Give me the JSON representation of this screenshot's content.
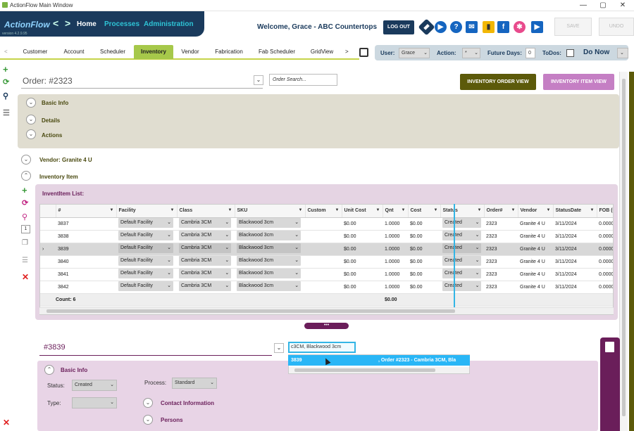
{
  "window": {
    "title": "ActionFlow Main Window",
    "min": "—",
    "max": "▢",
    "close": "✕"
  },
  "nav": {
    "logo": "ActionFlow",
    "version": "version 4.2.9.95",
    "back": "<",
    "fwd": ">",
    "items": [
      "Home",
      "Processes",
      "Administration"
    ]
  },
  "header": {
    "welcome": "Welcome, Grace - ABC Countertops",
    "logout": "LOG OUT",
    "save": "SAVE",
    "undo": "UNDO"
  },
  "tabs": {
    "prev": "<",
    "items": [
      "Customer",
      "Account",
      "Scheduler",
      "Inventory",
      "Vendor",
      "Fabrication",
      "Fab Scheduler",
      "GridView"
    ],
    "next": ">",
    "active": "Inventory"
  },
  "filters": {
    "user_label": "User:",
    "user_value": "Grace",
    "action_label": "Action:",
    "action_value": "*",
    "future_label": "Future Days:",
    "future_value": "0",
    "todos_label": "ToDos:",
    "donow": "Do Now"
  },
  "order": {
    "title": "Order:  #2323",
    "search_placeholder": "Order Search...",
    "btn_order_view": "INVENTORY ORDER VIEW",
    "btn_item_view": "INVENTORY ITEM VIEW",
    "sections": [
      "Basic Info",
      "Details",
      "Actions"
    ]
  },
  "vendor": {
    "label": "Vendor: Granite 4 U",
    "inv_label": "Inventory Item"
  },
  "invlist": {
    "title": "InventItem List:",
    "columns": [
      "#",
      "Facility",
      "Class",
      "SKU",
      "Custom",
      "Unit Cost",
      "Qnt",
      "Cost",
      "Status",
      "Order#",
      "Vendor",
      "StatusDate",
      "FOB (Ordered C"
    ],
    "rows": [
      [
        "3837",
        "Default Facility",
        "Cambria 3CM",
        "Blackwood 3cm",
        "",
        "$0.00",
        "1.0000",
        "$0.00",
        "Created",
        "2323",
        "Granite 4 U",
        "3/11/2024",
        "0.0000"
      ],
      [
        "3838",
        "Default Facility",
        "Cambria 3CM",
        "Blackwood 3cm",
        "",
        "$0.00",
        "1.0000",
        "$0.00",
        "Created",
        "2323",
        "Granite 4 U",
        "3/11/2024",
        "0.0000"
      ],
      [
        "3839",
        "Default Facility",
        "Cambria 3CM",
        "Blackwood 3cm",
        "",
        "$0.00",
        "1.0000",
        "$0.00",
        "Created",
        "2323",
        "Granite 4 U",
        "3/11/2024",
        "0.0000"
      ],
      [
        "3840",
        "Default Facility",
        "Cambria 3CM",
        "Blackwood 3cm",
        "",
        "$0.00",
        "1.0000",
        "$0.00",
        "Created",
        "2323",
        "Granite 4 U",
        "3/11/2024",
        "0.0000"
      ],
      [
        "3841",
        "Default Facility",
        "Cambria 3CM",
        "Blackwood 3cm",
        "",
        "$0.00",
        "1.0000",
        "$0.00",
        "Created",
        "2323",
        "Granite 4 U",
        "3/11/2024",
        "0.0000"
      ],
      [
        "3842",
        "Default Facility",
        "Cambria 3CM",
        "Blackwood 3cm",
        "",
        "$0.00",
        "1.0000",
        "$0.00",
        "Created",
        "2323",
        "Granite 4 U",
        "3/11/2024",
        "0.0000"
      ]
    ],
    "count": "Count: 6",
    "cost_total": "$0.00",
    "selected_row": 2
  },
  "divider": "•••",
  "item": {
    "title": "#3839",
    "basic": "Basic Info",
    "status_label": "Status:",
    "status_value": "Created",
    "process_label": "Process:",
    "process_value": "Standard",
    "type_label": "Type:",
    "contact": "Contact Information",
    "persons": "Persons"
  },
  "autocomplete": {
    "value": "c3CM, Blackwood 3cm",
    "item_id": "3839",
    "item_text": ", Order #2323 - Cambria 3CM, Bla"
  },
  "colors": {
    "nav": "#1a3a5c",
    "accent": "#a6c84a",
    "purple": "#6a1e5a",
    "olive": "#5c5a0a"
  }
}
